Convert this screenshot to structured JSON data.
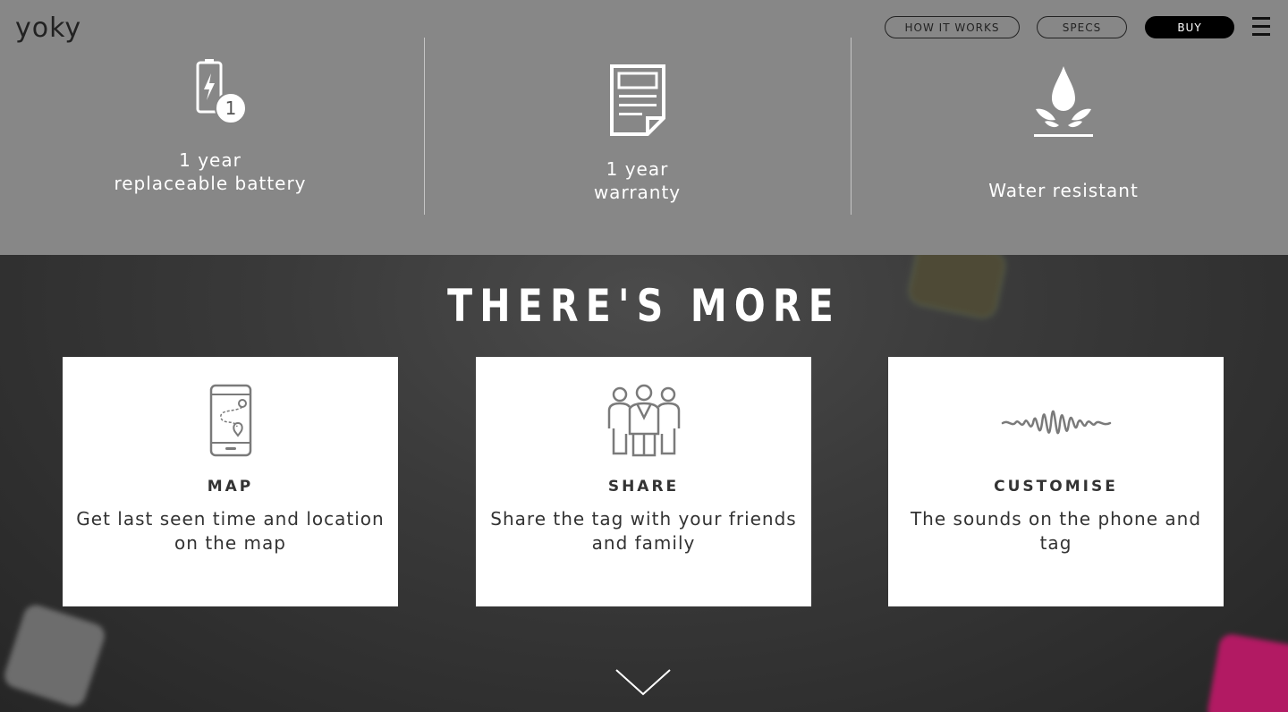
{
  "header": {
    "logo_text": "yoky",
    "nav": {
      "how_it_works": "HOW IT WORKS",
      "specs": "SPECS",
      "buy": "BUY"
    }
  },
  "features": [
    {
      "line1": "1 year",
      "line2": "replaceable battery",
      "icon": "battery-icon",
      "badge": "1"
    },
    {
      "line1": "1 year",
      "line2": "warranty",
      "icon": "document-icon"
    },
    {
      "line1": "Water resistant",
      "icon": "water-drop-icon"
    }
  ],
  "more": {
    "title": "THERE'S MORE",
    "cards": [
      {
        "title": "MAP",
        "desc": "Get last seen time and location on the map",
        "icon": "phone-map-icon"
      },
      {
        "title": "SHARE",
        "desc": "Share the tag with your friends and family",
        "icon": "people-icon"
      },
      {
        "title": "CUSTOMISE",
        "desc": "The sounds on the phone and tag",
        "icon": "soundwave-icon"
      }
    ]
  },
  "colors": {
    "top_band": "#878787",
    "dark_bg": "#2f2f2f",
    "card_bg": "#ffffff"
  }
}
